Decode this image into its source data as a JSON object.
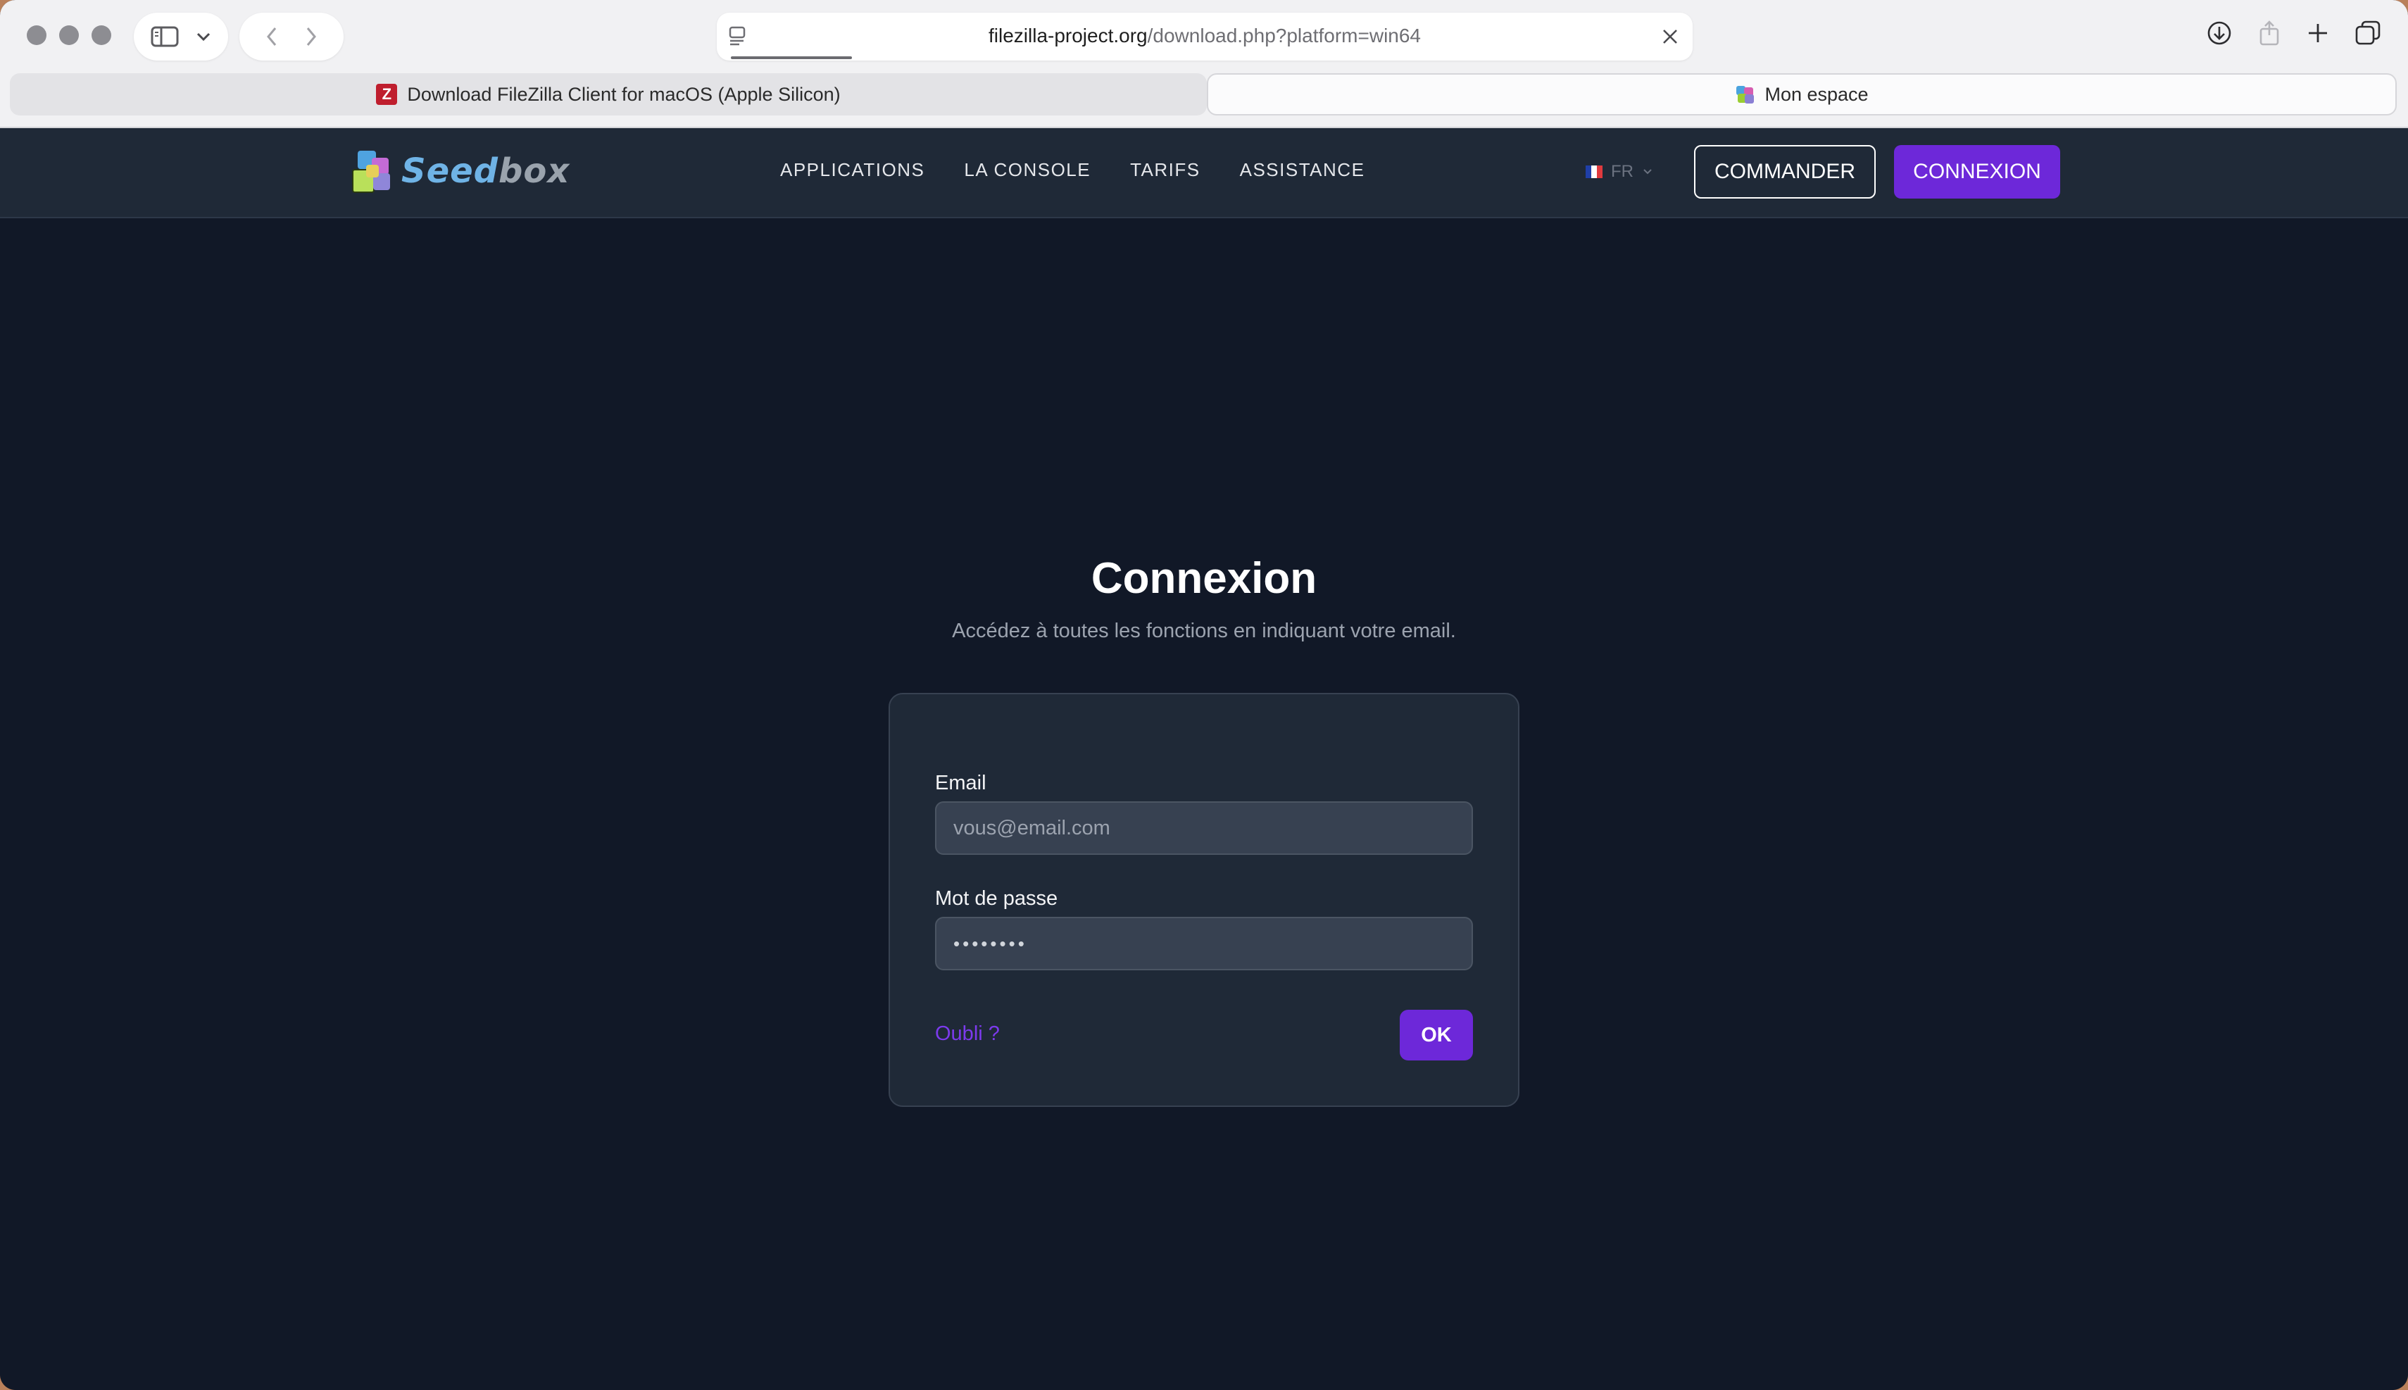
{
  "browser": {
    "url_host": "filezilla-project.org",
    "url_path": "/download.php?platform=win64",
    "tabs": [
      {
        "title": "Download FileZilla Client for macOS (Apple Silicon)",
        "icon": "filezilla-icon",
        "icon_letter": "Z"
      },
      {
        "title": "Mon espace",
        "icon": "seedbox-icon"
      }
    ]
  },
  "header": {
    "logo_prefix": "Seed",
    "logo_suffix": "box",
    "nav": [
      "APPLICATIONS",
      "LA CONSOLE",
      "TARIFS",
      "ASSISTANCE"
    ],
    "language": "FR",
    "order_label": "COMMANDER",
    "login_label": "CONNEXION"
  },
  "main": {
    "title": "Connexion",
    "subtitle": "Accédez à toutes les fonctions en indiquant votre email.",
    "form": {
      "email_label": "Email",
      "email_placeholder": "vous@email.com",
      "password_label": "Mot de passe",
      "password_value": "••••••••",
      "forgot_label": "Oubli ?",
      "submit_label": "OK"
    }
  },
  "colors": {
    "accent": "#6d28d9",
    "page_bg": "#111827",
    "header_bg": "#1f2937",
    "card_bg": "#1f2937"
  }
}
